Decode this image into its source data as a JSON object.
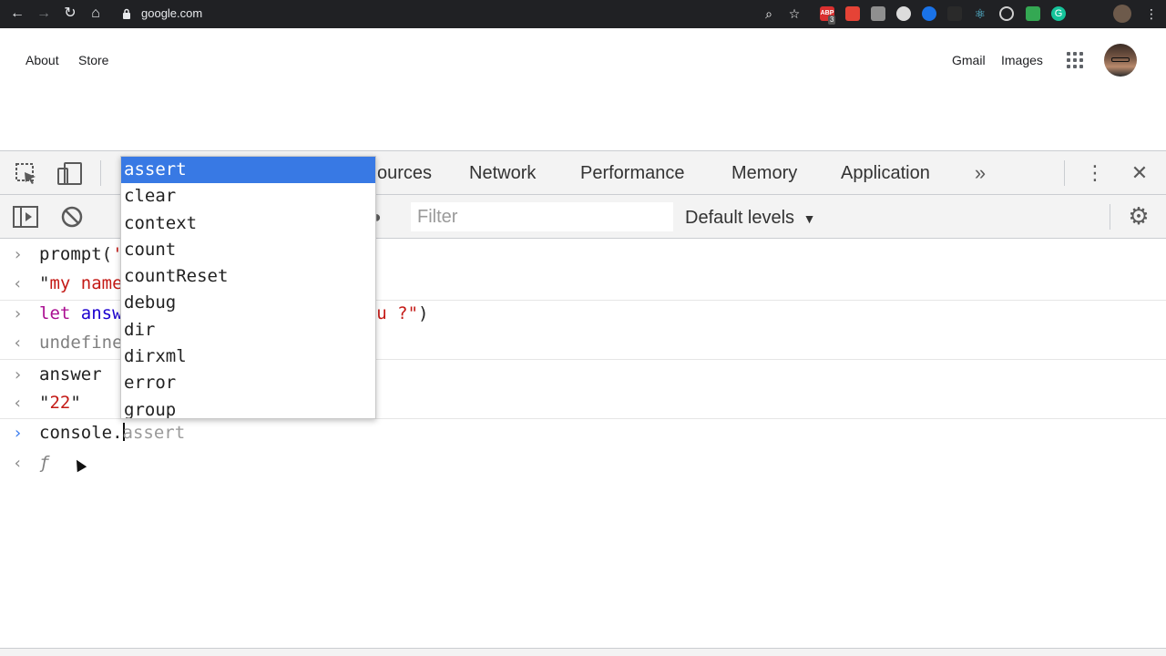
{
  "browser": {
    "url": "google.com",
    "abp_badge": "3"
  },
  "google": {
    "about": "About",
    "store": "Store",
    "gmail": "Gmail",
    "images": "Images"
  },
  "devtools": {
    "tabs": [
      "ources",
      "Network",
      "Performance",
      "Memory",
      "Application"
    ],
    "filter_placeholder": "Filter",
    "levels_label": "Default levels"
  },
  "console": {
    "lines": {
      "l1_in_a": "prompt(",
      "l1_in_b": "'",
      "l1_out_a": "\"",
      "l1_out_b": "my name",
      "l2_in_kw": "let ",
      "l2_in_var": "answ",
      "l2_in_str": "e you ?\"",
      "l2_in_end": ")",
      "l2_out": "undefine",
      "l3_in": "answer",
      "l3_out_q1": "\"",
      "l3_out_val": "22",
      "l3_out_q2": "\"",
      "l4_in": "console.",
      "l4_ghost": "assert",
      "l4_out": "ƒ"
    }
  },
  "autocomplete": {
    "items": [
      "assert",
      "clear",
      "context",
      "count",
      "countReset",
      "debug",
      "dir",
      "dirxml",
      "error",
      "group"
    ]
  }
}
